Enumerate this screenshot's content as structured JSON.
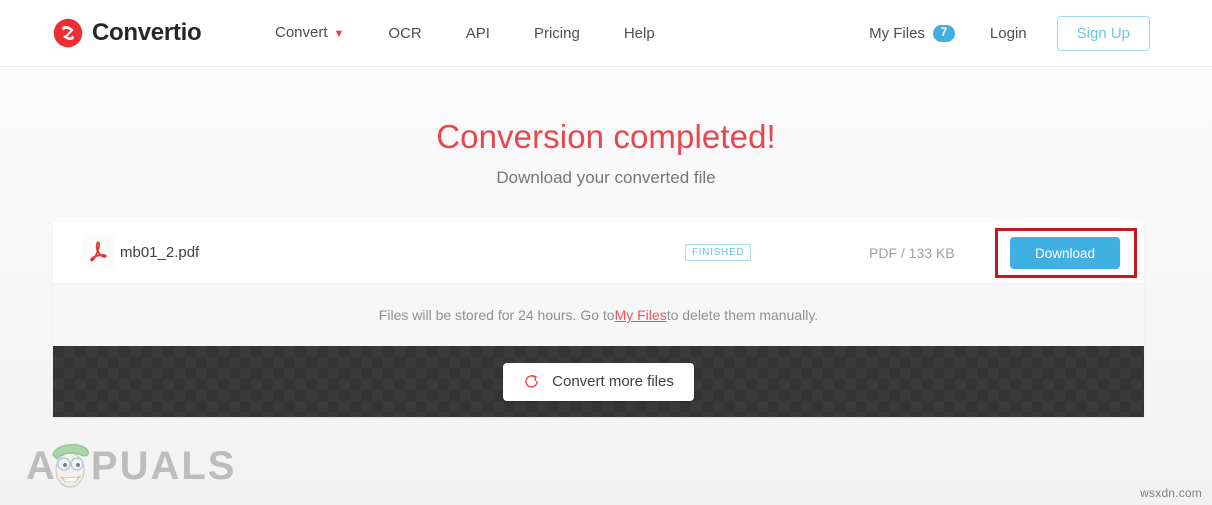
{
  "header": {
    "brand": {
      "name": "Convertio",
      "logo_icon": "convertio-logo-icon",
      "color": "#ee2e33"
    },
    "nav": [
      {
        "label": "Convert",
        "has_dropdown": true,
        "dropdown_icon": "chevron-down-icon"
      },
      {
        "label": "OCR",
        "has_dropdown": false
      },
      {
        "label": "API",
        "has_dropdown": false
      },
      {
        "label": "Pricing",
        "has_dropdown": false
      },
      {
        "label": "Help",
        "has_dropdown": false
      }
    ],
    "my_files": {
      "label": "My Files",
      "count": "7",
      "badge_color": "#3fb0e0"
    },
    "login": {
      "label": "Login"
    },
    "sign_up": {
      "label": "Sign Up",
      "color": "#6ec4e8"
    }
  },
  "hero": {
    "title": "Conversion completed!",
    "title_color": "#e8464f",
    "subtitle": "Download your converted file"
  },
  "file_row": {
    "file_icon": "pdf-file-icon",
    "file_name": "mb01_2.pdf",
    "status": "FINISHED",
    "status_color": "#6cc0e4",
    "meta": "PDF / 133 KB",
    "download_label": "Download",
    "download_color": "#40b0e2",
    "highlight_color": "#c7161c"
  },
  "notice": {
    "before_link": "Files will be stored for 24 hours. Go to ",
    "link": "My Files",
    "after_link": " to delete them manually.",
    "link_color": "#e8555c"
  },
  "footer": {
    "convert_more_label": "Convert more files",
    "convert_more_icon": "refresh-icon",
    "icon_color": "#e8464f"
  },
  "watermarks": {
    "appuals_prefix": "A",
    "appuals_suffix": "PUALS",
    "site": "wsxdn.com"
  }
}
